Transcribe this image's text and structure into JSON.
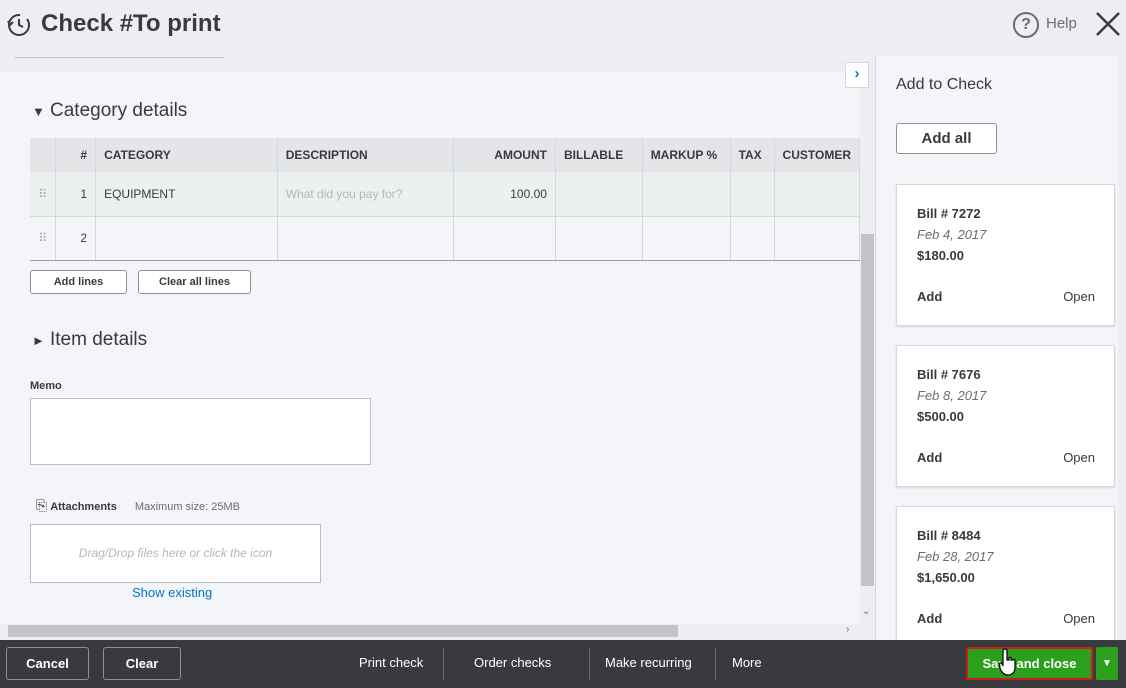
{
  "header": {
    "title": "Check #To print",
    "help_label": "Help"
  },
  "category": {
    "heading": "Category details",
    "columns": [
      "#",
      "CATEGORY",
      "DESCRIPTION",
      "AMOUNT",
      "BILLABLE",
      "MARKUP %",
      "TAX",
      "CUSTOMER"
    ],
    "rows": [
      {
        "num": "1",
        "category": "EQUIPMENT",
        "description_placeholder": "What did you pay for?",
        "amount": "100.00"
      },
      {
        "num": "2",
        "category": "",
        "description_placeholder": "",
        "amount": ""
      }
    ],
    "add_lines_label": "Add lines",
    "clear_lines_label": "Clear all lines"
  },
  "items": {
    "heading": "Item details"
  },
  "memo": {
    "label": "Memo",
    "value": ""
  },
  "attachments": {
    "label": "Attachments",
    "max_size": "Maximum size: 25MB",
    "dropzone_text": "Drag/Drop files here or click the icon",
    "show_existing": "Show existing"
  },
  "panel": {
    "title": "Add to Check",
    "add_all_label": "Add all",
    "bills": [
      {
        "number": "Bill # 7272",
        "date": "Feb 4, 2017",
        "amount": "$180.00",
        "add": "Add",
        "open": "Open"
      },
      {
        "number": "Bill # 7676",
        "date": "Feb 8, 2017",
        "amount": "$500.00",
        "add": "Add",
        "open": "Open"
      },
      {
        "number": "Bill # 8484",
        "date": "Feb 28, 2017",
        "amount": "$1,650.00",
        "add": "Add",
        "open": "Open"
      }
    ]
  },
  "footer": {
    "cancel": "Cancel",
    "clear": "Clear",
    "print_check": "Print check",
    "order_checks": "Order checks",
    "make_recurring": "Make recurring",
    "more": "More",
    "save_close": "Save and close"
  },
  "colors": {
    "primary_green": "#2ca01c",
    "footer_bg": "#393a3d",
    "link_blue": "#0077c5"
  }
}
